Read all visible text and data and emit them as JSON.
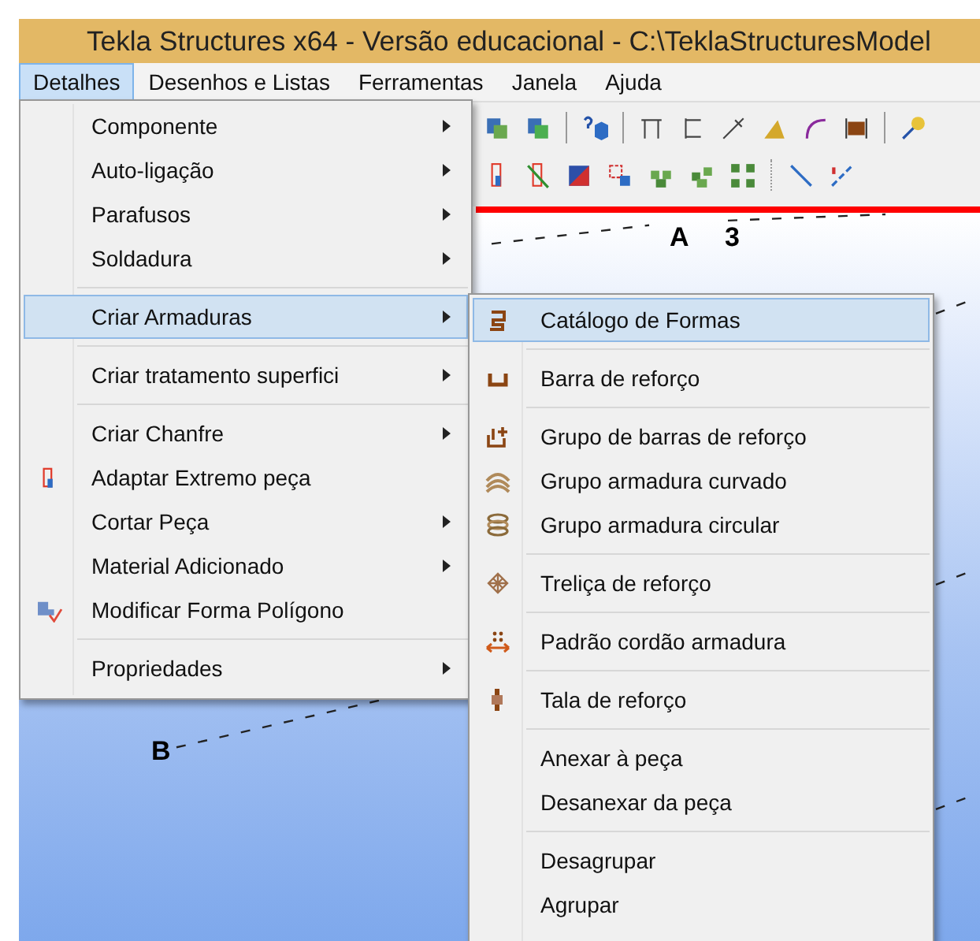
{
  "window": {
    "title": "Tekla Structures x64 - Versão educacional - C:\\TeklaStructuresModel"
  },
  "menubar": [
    {
      "label": "Detalhes",
      "selected": true
    },
    {
      "label": "Desenhos e Listas",
      "selected": false
    },
    {
      "label": "Ferramentas",
      "selected": false
    },
    {
      "label": "Janela",
      "selected": false
    },
    {
      "label": "Ajuda",
      "selected": false
    }
  ],
  "menu": {
    "items": [
      {
        "kind": "item",
        "label": "Componente",
        "submenu": true,
        "selected": false
      },
      {
        "kind": "item",
        "label": "Auto-ligação",
        "submenu": true,
        "selected": false
      },
      {
        "kind": "item",
        "label": "Parafusos",
        "submenu": true,
        "selected": false
      },
      {
        "kind": "item",
        "label": "Soldadura",
        "submenu": true,
        "selected": false
      },
      {
        "kind": "separator"
      },
      {
        "kind": "item",
        "label": "Criar Armaduras",
        "submenu": true,
        "selected": true
      },
      {
        "kind": "separator"
      },
      {
        "kind": "item",
        "label": "Criar tratamento superfici",
        "submenu": true,
        "selected": false
      },
      {
        "kind": "separator"
      },
      {
        "kind": "item",
        "label": "Criar Chanfre",
        "submenu": true,
        "selected": false
      },
      {
        "kind": "item",
        "label": "Adaptar Extremo peça",
        "submenu": false,
        "selected": false
      },
      {
        "kind": "item",
        "label": "Cortar Peça",
        "submenu": true,
        "selected": false
      },
      {
        "kind": "item",
        "label": "Material Adicionado",
        "submenu": true,
        "selected": false
      },
      {
        "kind": "item",
        "label": "Modificar Forma Polígono",
        "submenu": false,
        "selected": false
      },
      {
        "kind": "separator"
      },
      {
        "kind": "item",
        "label": "Propriedades",
        "submenu": true,
        "selected": false
      }
    ]
  },
  "submenu": {
    "items": [
      {
        "kind": "item",
        "label": "Catálogo de Formas",
        "selected": true
      },
      {
        "kind": "separator"
      },
      {
        "kind": "item",
        "label": "Barra de reforço",
        "selected": false
      },
      {
        "kind": "separator"
      },
      {
        "kind": "item",
        "label": "Grupo de barras de reforço",
        "selected": false
      },
      {
        "kind": "item",
        "label": "Grupo armadura curvado",
        "selected": false
      },
      {
        "kind": "item",
        "label": "Grupo armadura circular",
        "selected": false
      },
      {
        "kind": "separator"
      },
      {
        "kind": "item",
        "label": "Treliça de reforço",
        "selected": false
      },
      {
        "kind": "separator"
      },
      {
        "kind": "item",
        "label": "Padrão cordão armadura",
        "selected": false
      },
      {
        "kind": "separator"
      },
      {
        "kind": "item",
        "label": "Tala de reforço",
        "selected": false
      },
      {
        "kind": "separator"
      },
      {
        "kind": "item",
        "label": "Anexar à peça",
        "selected": false
      },
      {
        "kind": "item",
        "label": "Desanexar da peça",
        "selected": false
      },
      {
        "kind": "separator"
      },
      {
        "kind": "item",
        "label": "Desagrupar",
        "selected": false
      },
      {
        "kind": "item",
        "label": "Agrupar",
        "selected": false
      }
    ]
  },
  "viewport": {
    "labels": [
      {
        "text": "A"
      },
      {
        "text": "3"
      },
      {
        "text": "B"
      }
    ]
  }
}
